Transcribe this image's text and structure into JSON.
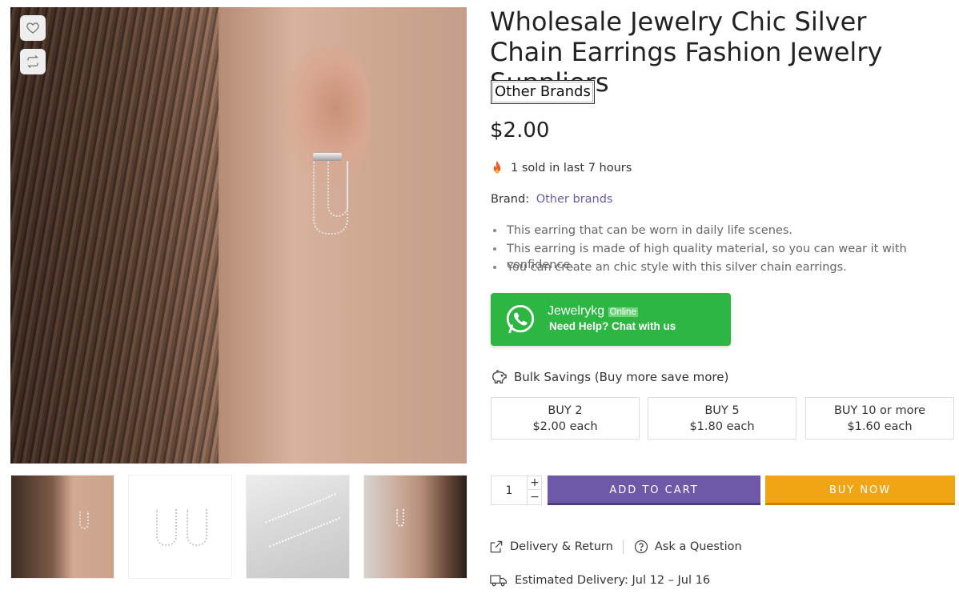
{
  "product": {
    "title": "Wholesale Jewelry Chic Silver Chain Earrings Fashion Jewelry Suppliers",
    "brand_chip": "Other Brands",
    "price": "$2.00",
    "sold_text": "1 sold in last 7 hours",
    "brand_label": "Brand:",
    "brand_link": "Other brands",
    "features": [
      "This earring that can be worn in daily life scenes.",
      "This earring is made of high quality material, so you can wear it with confidence.",
      "You can create an chic style with this silver chain earrings."
    ]
  },
  "gallery": {
    "main_image_icon": "earring-on-ear-photo",
    "thumbnails": [
      "earring-on-ear",
      "earrings-pair-white",
      "earrings-flat-gray",
      "earring-side-profile"
    ]
  },
  "whatsapp": {
    "name": "Jewelrykg",
    "status": "Online",
    "help_text": "Need Help? Chat with us",
    "color": "#2db742"
  },
  "bulk": {
    "title": "Bulk Savings (Buy more save more)",
    "tiers": [
      {
        "label": "BUY 2",
        "price": "$2.00 each"
      },
      {
        "label": "BUY 5",
        "price": "$1.80 each"
      },
      {
        "label": "BUY 10 or more",
        "price": "$1.60 each"
      }
    ]
  },
  "cart": {
    "quantity": "1",
    "plus": "+",
    "minus": "−",
    "add_to_cart": "ADD TO CART",
    "buy_now": "BUY NOW",
    "add_to_cart_color": "#6e58a8",
    "buy_now_color": "#f0a515"
  },
  "links": {
    "delivery_return": "Delivery & Return",
    "ask_question": "Ask a Question"
  },
  "delivery": {
    "text": "Estimated Delivery: Jul 12 – Jul 16"
  }
}
